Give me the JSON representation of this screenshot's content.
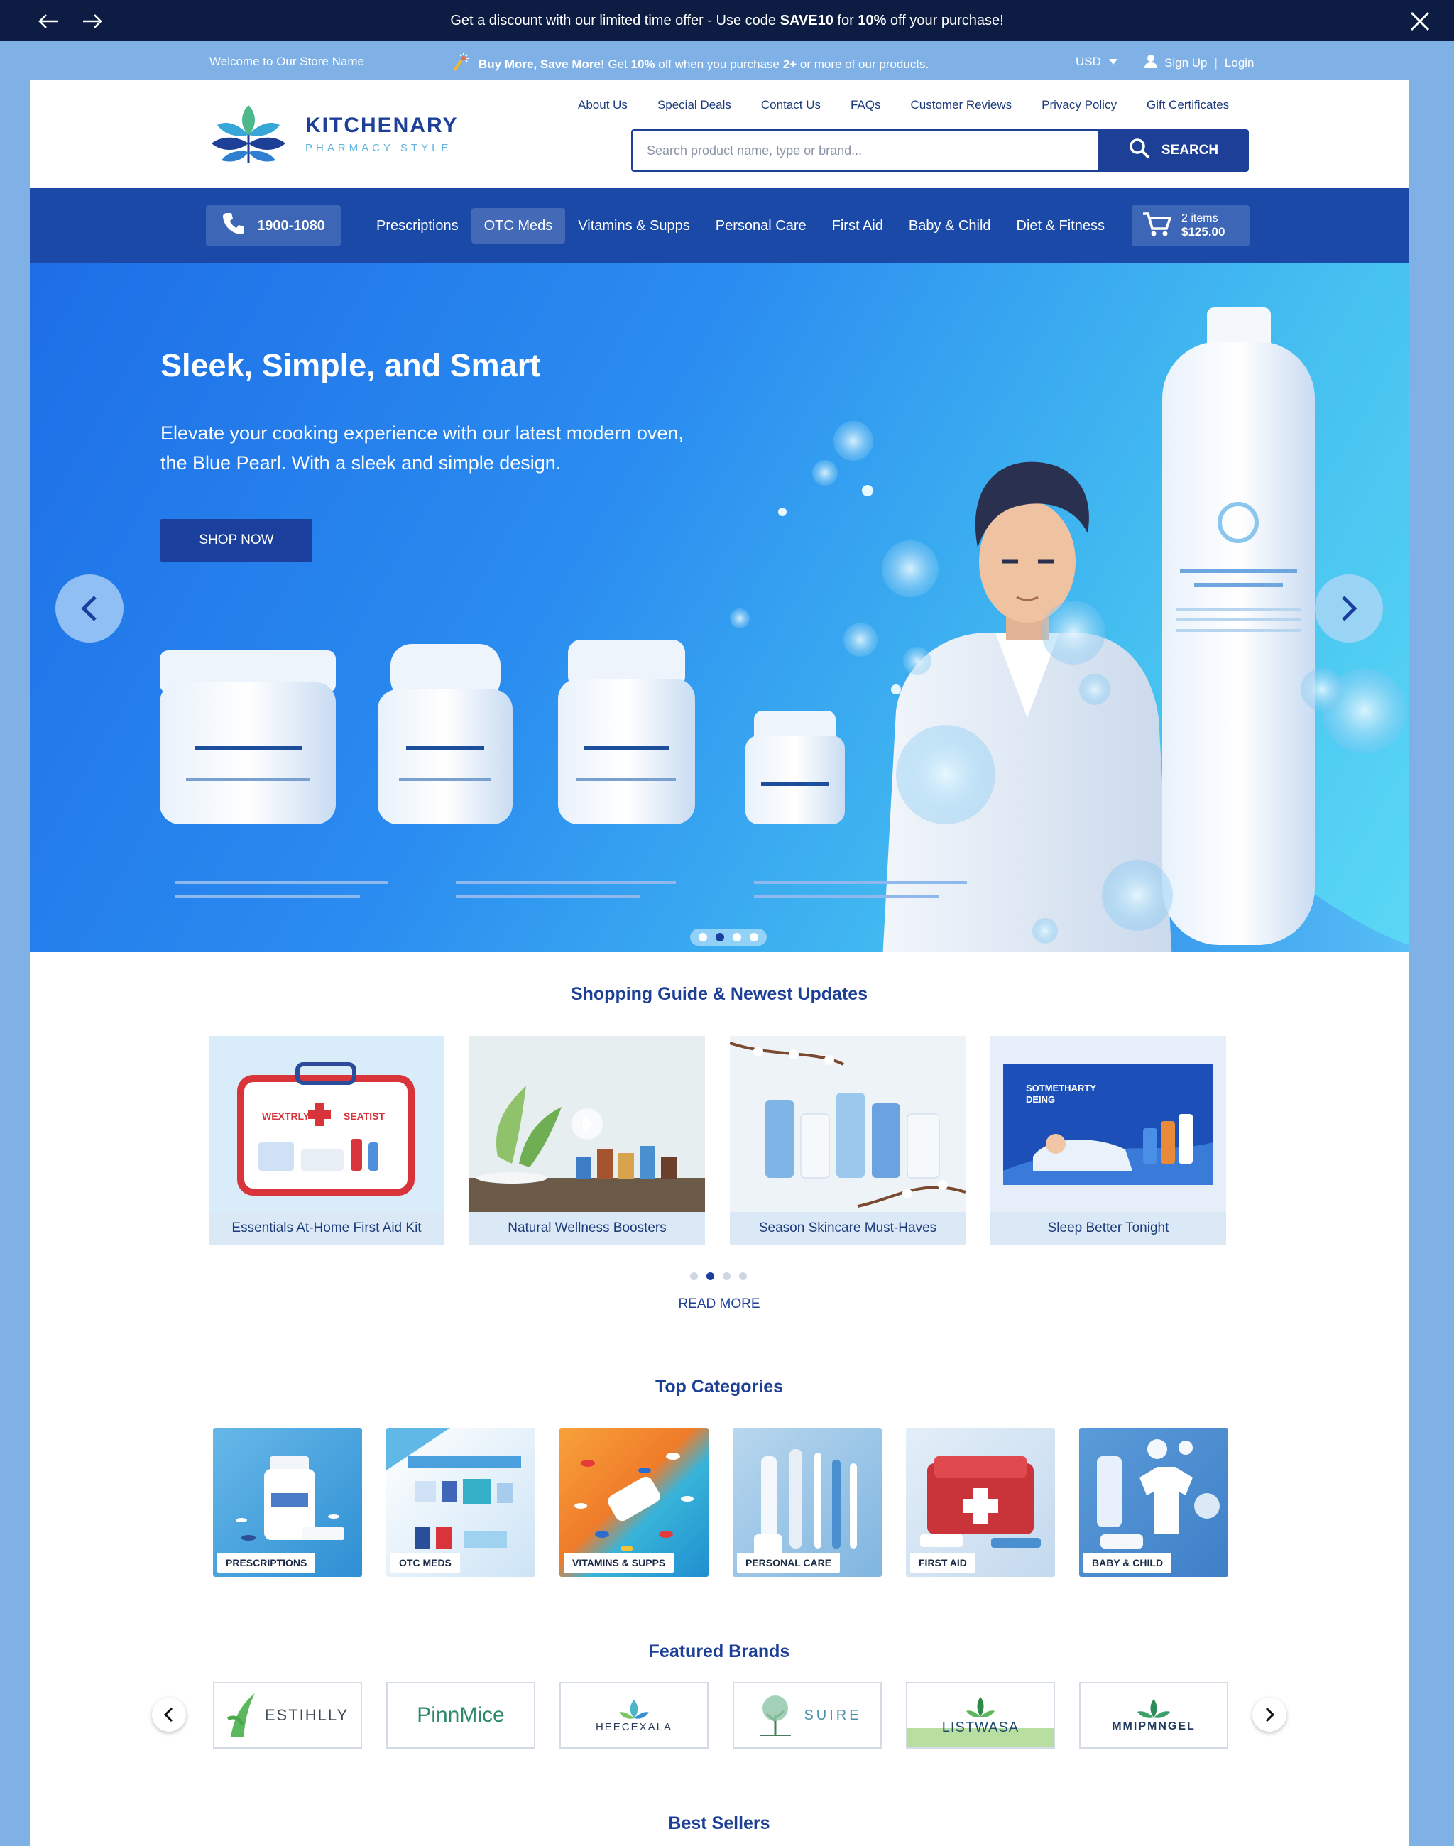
{
  "announcement": {
    "text_pre": "Get a discount with our limited time offer - Use code",
    "code": "SAVE10",
    "text_mid": "for",
    "percent": "10%",
    "text_post": "off your purchase!"
  },
  "utility": {
    "welcome": "Welcome to Our Store Name",
    "promo_bold": "Buy More, Save More!",
    "promo_text1": "Get",
    "promo_pct": "10%",
    "promo_text2": "off when you purchase",
    "promo_qty": "2+",
    "promo_text3": "or more of our products.",
    "currency": "USD",
    "signup": "Sign Up",
    "separator": "|",
    "login": "Login"
  },
  "logo": {
    "name": "KITCHENARY",
    "tagline": "PHARMACY STYLE"
  },
  "toplinks": [
    "About Us",
    "Special Deals",
    "Contact Us",
    "FAQs",
    "Customer Reviews",
    "Privacy Policy",
    "Gift Certificates"
  ],
  "search": {
    "placeholder": "Search product name, type or brand...",
    "button": "SEARCH"
  },
  "nav": {
    "phone": "1900-1080",
    "items": [
      "Prescriptions",
      "OTC Meds",
      "Vitamins & Supps",
      "Personal Care",
      "First Aid",
      "Baby & Child",
      "Diet & Fitness"
    ],
    "active_index": 1,
    "cart_items": "2 items",
    "cart_total": "$125.00"
  },
  "hero": {
    "title": "Sleek, Simple, and Smart",
    "subtitle": "Elevate your cooking experience with our latest modern oven, the Blue Pearl. With a sleek and simple design.",
    "cta": "SHOP NOW",
    "slide_count": 4,
    "active_slide": 2
  },
  "guide": {
    "title": "Shopping Guide & Newest Updates",
    "cards": [
      {
        "caption": "Essentials At-Home First Aid Kit"
      },
      {
        "caption": "Natural Wellness Boosters"
      },
      {
        "caption": "Season Skincare Must-Haves"
      },
      {
        "caption": "Sleep Better Tonight"
      }
    ],
    "read_more": "READ MORE"
  },
  "categories": {
    "title": "Top Categories",
    "items": [
      "PRESCRIPTIONS",
      "OTC MEDS",
      "VITAMINS & SUPPS",
      "PERSONAL CARE",
      "FIRST AID",
      "BABY & CHILD"
    ]
  },
  "brands": {
    "title": "Featured Brands",
    "items": [
      "ESTIHLLY",
      "PinnMice",
      "HEECEXALA",
      "SUIRE",
      "LISTWASA",
      "MMIPMNGEL"
    ]
  },
  "best_sellers": {
    "title": "Best Sellers"
  },
  "colors": {
    "primary": "#1a49a8",
    "dark": "#0c1c42",
    "accent": "#5fb3dd",
    "background": "#7fb1e6"
  },
  "icons": [
    "arrow-left-icon",
    "arrow-right-icon",
    "close-icon",
    "fireworks-icon",
    "caret-down-icon",
    "user-icon",
    "search-icon",
    "phone-icon",
    "cart-icon",
    "chevron-left-icon",
    "chevron-right-icon"
  ]
}
